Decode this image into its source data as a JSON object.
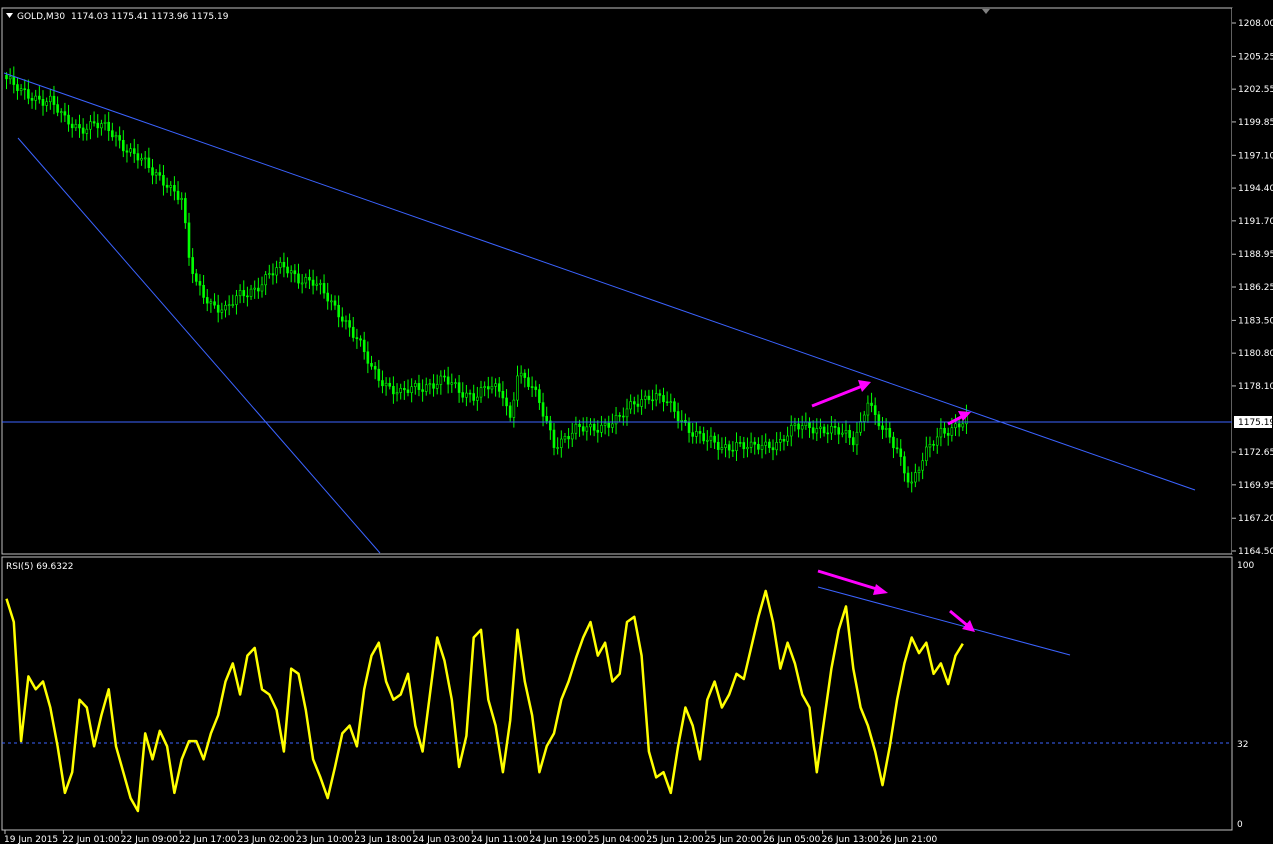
{
  "header": {
    "symbol": "GOLD,M30",
    "ohlc": "1174.03 1175.41 1173.96 1175.19"
  },
  "indicator": {
    "label": "RSI(5) 69.6322",
    "levels": [
      "100",
      "32",
      "0"
    ]
  },
  "colors": {
    "background": "#000000",
    "frame": "#c0c0c0",
    "candle": "#00ff00",
    "trendline": "#3b63ff",
    "rsi": "#ffff00",
    "arrow": "#ff00ff",
    "label_bg": "#ffffff"
  },
  "chart_data": [
    {
      "type": "candlestick",
      "symbol": "GOLD",
      "timeframe": "M30",
      "current_price": "1175.19",
      "y_axis_ticks": [
        "1208.00",
        "1205.25",
        "1202.55",
        "1199.85",
        "1197.10",
        "1194.40",
        "1191.70",
        "1188.95",
        "1186.25",
        "1183.50",
        "1180.80",
        "1178.10",
        "1172.65",
        "1169.95",
        "1167.20",
        "1164.50"
      ],
      "ylim": [
        1164.5,
        1209.0
      ],
      "x_axis_ticks": [
        "19 Jun 2015",
        "22 Jun 01:00",
        "22 Jun 09:00",
        "22 Jun 17:00",
        "23 Jun 02:00",
        "23 Jun 10:00",
        "23 Jun 18:00",
        "24 Jun 03:00",
        "24 Jun 11:00",
        "24 Jun 19:00",
        "25 Jun 04:00",
        "25 Jun 12:00",
        "25 Jun 20:00",
        "26 Jun 05:00",
        "26 Jun 13:00",
        "26 Jun 21:00"
      ],
      "bars_per_tick": 16,
      "close_path": [
        [
          0,
          1203.4
        ],
        [
          4,
          1202.2
        ],
        [
          8,
          1201.9
        ],
        [
          12,
          1201.6
        ],
        [
          16,
          1199.9
        ],
        [
          20,
          1199.4
        ],
        [
          24,
          1199.7
        ],
        [
          28,
          1199.1
        ],
        [
          32,
          1198.0
        ],
        [
          36,
          1197.0
        ],
        [
          40,
          1195.6
        ],
        [
          44,
          1194.9
        ],
        [
          48,
          1193.5
        ],
        [
          50,
          1188.5
        ],
        [
          52,
          1186.4
        ],
        [
          56,
          1185.0
        ],
        [
          60,
          1184.3
        ],
        [
          64,
          1185.5
        ],
        [
          68,
          1186.2
        ],
        [
          72,
          1187.2
        ],
        [
          76,
          1187.9
        ],
        [
          80,
          1187.1
        ],
        [
          84,
          1186.6
        ],
        [
          88,
          1185.3
        ],
        [
          92,
          1183.9
        ],
        [
          96,
          1181.9
        ],
        [
          100,
          1179.5
        ],
        [
          104,
          1178.3
        ],
        [
          108,
          1177.4
        ],
        [
          112,
          1177.9
        ],
        [
          116,
          1178.3
        ],
        [
          120,
          1178.6
        ],
        [
          124,
          1177.6
        ],
        [
          128,
          1177.4
        ],
        [
          132,
          1178.0
        ],
        [
          136,
          1177.4
        ],
        [
          138,
          1175.4
        ],
        [
          140,
          1179.4
        ],
        [
          144,
          1177.9
        ],
        [
          148,
          1175.1
        ],
        [
          150,
          1173.4
        ],
        [
          152,
          1173.7
        ],
        [
          156,
          1174.4
        ],
        [
          160,
          1174.6
        ],
        [
          164,
          1175.0
        ],
        [
          168,
          1175.3
        ],
        [
          172,
          1176.7
        ],
        [
          176,
          1177.4
        ],
        [
          180,
          1176.9
        ],
        [
          184,
          1175.6
        ],
        [
          188,
          1174.4
        ],
        [
          192,
          1173.5
        ],
        [
          196,
          1173.0
        ],
        [
          200,
          1173.4
        ],
        [
          204,
          1172.9
        ],
        [
          208,
          1173.2
        ],
        [
          212,
          1173.6
        ],
        [
          216,
          1174.6
        ],
        [
          220,
          1174.8
        ],
        [
          224,
          1174.6
        ],
        [
          228,
          1174.2
        ],
        [
          232,
          1173.7
        ],
        [
          234,
          1175.1
        ],
        [
          236,
          1177.1
        ],
        [
          238,
          1175.4
        ],
        [
          240,
          1174.4
        ],
        [
          244,
          1173.0
        ],
        [
          246,
          1171.3
        ],
        [
          248,
          1170.1
        ],
        [
          252,
          1172.5
        ],
        [
          256,
          1174.4
        ],
        [
          260,
          1174.8
        ],
        [
          263,
          1175.19
        ]
      ]
    },
    {
      "type": "line",
      "name": "RSI(5)",
      "last_value": 69.6322,
      "ylim": [
        0,
        100
      ],
      "level": 32,
      "values": [
        [
          0,
          87
        ],
        [
          2,
          78
        ],
        [
          4,
          32
        ],
        [
          6,
          57
        ],
        [
          8,
          52
        ],
        [
          10,
          55
        ],
        [
          12,
          45
        ],
        [
          14,
          30
        ],
        [
          16,
          12
        ],
        [
          18,
          20
        ],
        [
          20,
          48
        ],
        [
          22,
          45
        ],
        [
          24,
          30
        ],
        [
          26,
          42
        ],
        [
          28,
          52
        ],
        [
          30,
          30
        ],
        [
          32,
          20
        ],
        [
          34,
          10
        ],
        [
          36,
          5
        ],
        [
          38,
          35
        ],
        [
          40,
          25
        ],
        [
          42,
          36
        ],
        [
          44,
          30
        ],
        [
          46,
          12
        ],
        [
          48,
          25
        ],
        [
          50,
          32
        ],
        [
          52,
          32
        ],
        [
          54,
          25
        ],
        [
          56,
          35
        ],
        [
          58,
          42
        ],
        [
          60,
          55
        ],
        [
          62,
          62
        ],
        [
          64,
          50
        ],
        [
          66,
          65
        ],
        [
          68,
          68
        ],
        [
          70,
          52
        ],
        [
          72,
          50
        ],
        [
          74,
          44
        ],
        [
          76,
          28
        ],
        [
          78,
          60
        ],
        [
          80,
          58
        ],
        [
          82,
          44
        ],
        [
          84,
          25
        ],
        [
          86,
          18
        ],
        [
          88,
          10
        ],
        [
          90,
          22
        ],
        [
          92,
          35
        ],
        [
          94,
          38
        ],
        [
          96,
          30
        ],
        [
          98,
          52
        ],
        [
          100,
          65
        ],
        [
          102,
          70
        ],
        [
          104,
          55
        ],
        [
          106,
          48
        ],
        [
          108,
          50
        ],
        [
          110,
          58
        ],
        [
          112,
          38
        ],
        [
          114,
          28
        ],
        [
          116,
          50
        ],
        [
          118,
          72
        ],
        [
          120,
          63
        ],
        [
          122,
          48
        ],
        [
          124,
          22
        ],
        [
          126,
          34
        ],
        [
          128,
          72
        ],
        [
          130,
          75
        ],
        [
          132,
          48
        ],
        [
          134,
          38
        ],
        [
          136,
          20
        ],
        [
          138,
          40
        ],
        [
          140,
          75
        ],
        [
          142,
          55
        ],
        [
          144,
          42
        ],
        [
          146,
          20
        ],
        [
          148,
          30
        ],
        [
          150,
          35
        ],
        [
          152,
          48
        ],
        [
          154,
          55
        ],
        [
          156,
          64
        ],
        [
          158,
          72
        ],
        [
          160,
          78
        ],
        [
          162,
          65
        ],
        [
          164,
          70
        ],
        [
          166,
          55
        ],
        [
          168,
          58
        ],
        [
          170,
          78
        ],
        [
          172,
          80
        ],
        [
          174,
          65
        ],
        [
          176,
          28
        ],
        [
          178,
          18
        ],
        [
          180,
          20
        ],
        [
          182,
          12
        ],
        [
          184,
          30
        ],
        [
          186,
          45
        ],
        [
          188,
          38
        ],
        [
          190,
          25
        ],
        [
          192,
          48
        ],
        [
          194,
          55
        ],
        [
          196,
          45
        ],
        [
          198,
          50
        ],
        [
          200,
          58
        ],
        [
          202,
          56
        ],
        [
          204,
          68
        ],
        [
          206,
          80
        ],
        [
          208,
          90
        ],
        [
          210,
          78
        ],
        [
          212,
          60
        ],
        [
          214,
          70
        ],
        [
          216,
          62
        ],
        [
          218,
          50
        ],
        [
          220,
          45
        ],
        [
          222,
          20
        ],
        [
          224,
          40
        ],
        [
          226,
          60
        ],
        [
          228,
          75
        ],
        [
          230,
          84
        ],
        [
          232,
          60
        ],
        [
          234,
          45
        ],
        [
          236,
          38
        ],
        [
          238,
          28
        ],
        [
          240,
          15
        ],
        [
          242,
          30
        ],
        [
          244,
          48
        ],
        [
          246,
          62
        ],
        [
          248,
          72
        ],
        [
          250,
          66
        ],
        [
          252,
          70
        ],
        [
          254,
          58
        ],
        [
          256,
          62
        ],
        [
          258,
          54
        ],
        [
          260,
          65
        ],
        [
          262,
          69.6322
        ]
      ]
    }
  ]
}
